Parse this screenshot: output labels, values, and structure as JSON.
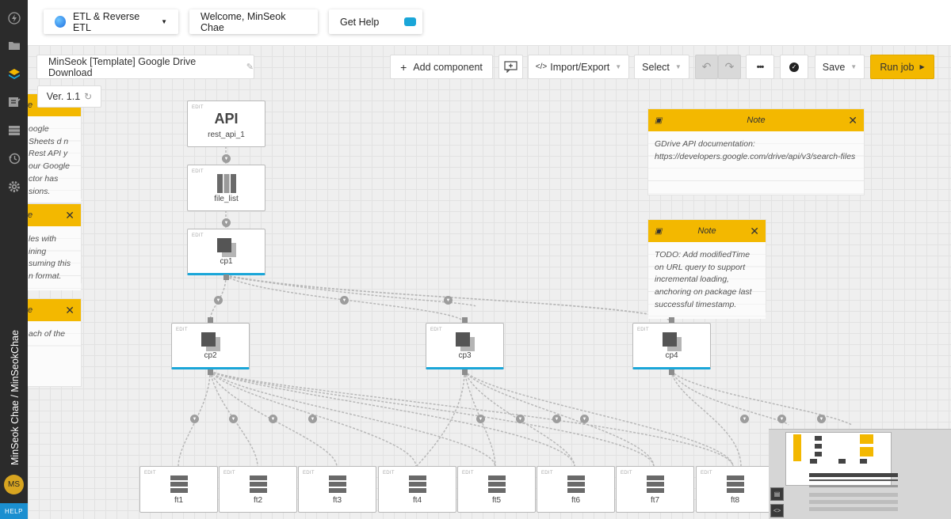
{
  "sidebar": {
    "user_path": "MinSeok Chae / MinSeokChae",
    "avatar_initials": "MS",
    "help_label": "HELP"
  },
  "header": {
    "product_label": "ETL & Reverse ETL",
    "welcome_label": "Welcome, MinSeok Chae",
    "help_label": "Get Help"
  },
  "toolbar": {
    "job_name": "MinSeok [Template] Google Drive Download",
    "add_component_label": "Add component",
    "import_export_label": "Import/Export",
    "select_label": "Select",
    "more_label": "•••",
    "save_label": "Save",
    "run_job_label": "Run job",
    "version_label": "Ver. 1.1"
  },
  "nodes": {
    "rest_api_1": {
      "icon_text": "API",
      "label": "rest_api_1"
    },
    "file_list": {
      "label": "file_list"
    },
    "cp1": {
      "label": "cp1"
    },
    "cp2": {
      "label": "cp2"
    },
    "cp3": {
      "label": "cp3"
    },
    "cp4": {
      "label": "cp4"
    },
    "ft": [
      {
        "label": "ft1"
      },
      {
        "label": "ft2"
      },
      {
        "label": "ft3"
      },
      {
        "label": "ft4"
      },
      {
        "label": "ft5"
      },
      {
        "label": "ft6"
      },
      {
        "label": "ft7"
      },
      {
        "label": "ft8"
      }
    ],
    "edit_label": "EDIT"
  },
  "notes": [
    {
      "title": "Note",
      "body": "GDrive API documentation: https://developers.google.com/drive/api/v3/search-files"
    },
    {
      "title": "Note",
      "body": "TODO: Add modifiedTime on URL query to support incremental loading, anchoring on package last successful timestamp."
    }
  ],
  "left_notes": [
    {
      "title": "te",
      "body": "oogle Sheets d n Rest API y our Google ctor has sions."
    },
    {
      "title": "te",
      "body": "les with ining suming this n format."
    },
    {
      "title": "te",
      "body": "ach of the"
    }
  ],
  "colors": {
    "accent": "#f3b800",
    "selected_border": "#1aa6d8",
    "sidebar_bg": "#2b2b2b"
  }
}
